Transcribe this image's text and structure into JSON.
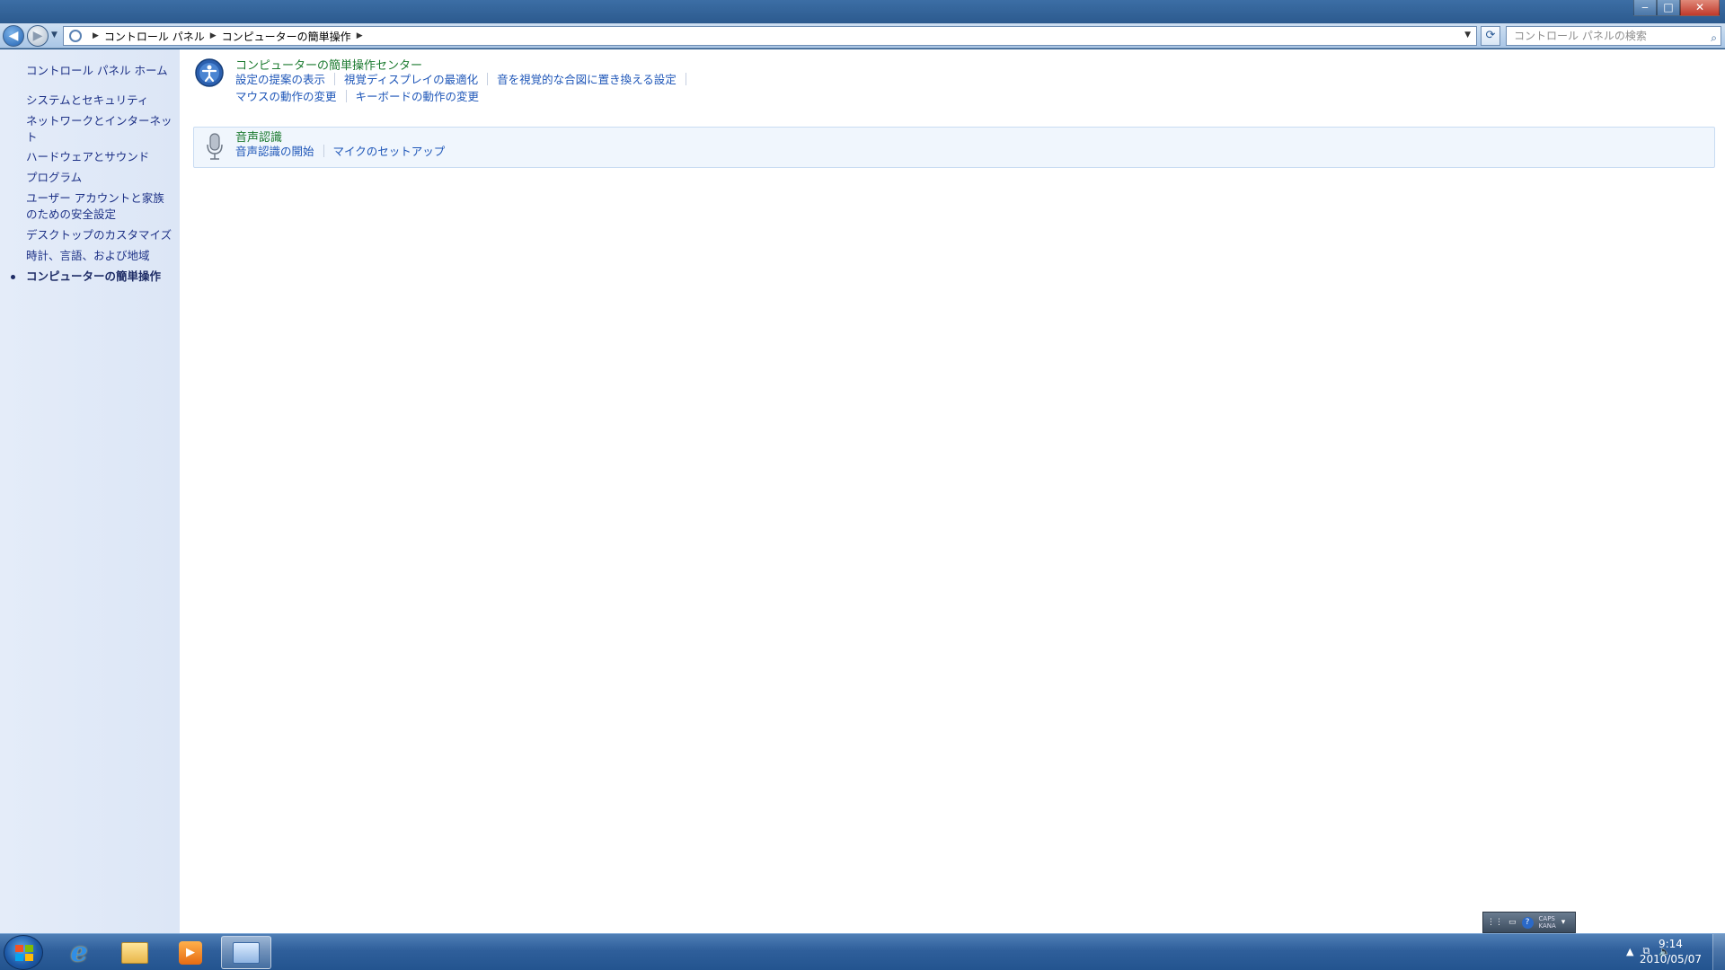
{
  "window": {
    "minimize": "‒",
    "maximize": "□",
    "close": "✕"
  },
  "navigation": {
    "back": "◀",
    "forward": "▶",
    "breadcrumb": [
      "コントロール パネル",
      "コンピューターの簡単操作"
    ],
    "search_placeholder": "コントロール パネルの検索"
  },
  "sidebar": {
    "items": [
      "コントロール パネル ホーム",
      "システムとセキュリティ",
      "ネットワークとインターネット",
      "ハードウェアとサウンド",
      "プログラム",
      "ユーザー アカウントと家族のための安全設定",
      "デスクトップのカスタマイズ",
      "時計、言語、および地域",
      "コンピューターの簡単操作"
    ]
  },
  "main": {
    "sections": [
      {
        "title": "コンピューターの簡単操作センター",
        "icon": "ease-of-access-icon",
        "links_row1": [
          "設定の提案の表示",
          "視覚ディスプレイの最適化",
          "音を視覚的な合図に置き換える設定"
        ],
        "links_row2": [
          "マウスの動作の変更",
          "キーボードの動作の変更"
        ]
      },
      {
        "title": "音声認識",
        "icon": "microphone-icon",
        "links_row1": [
          "音声認識の開始",
          "マイクのセットアップ"
        ]
      }
    ]
  },
  "language_bar": {
    "caps": "CAPS",
    "kana": "KANA",
    "help": "?"
  },
  "taskbar": {
    "apps": [
      "internet-explorer-icon",
      "windows-explorer-icon",
      "media-player-icon",
      "control-panel-icon"
    ],
    "tray_arrow": "▲",
    "time": "9:14",
    "date": "2010/05/07"
  },
  "colors": {
    "link": "#1e56b8",
    "section_title": "#1b7a2f",
    "sidebar_bg": "#e4ecf9"
  }
}
